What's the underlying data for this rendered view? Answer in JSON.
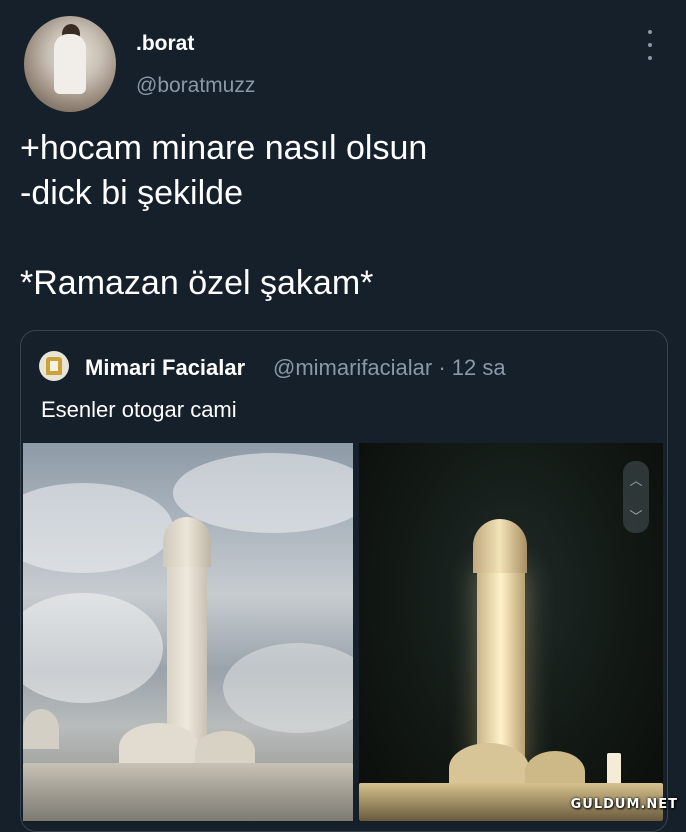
{
  "tweet": {
    "display_name": ".borat",
    "handle": "@boratmuzz",
    "text": "+hocam minare nasıl olsun\n-dick bi şekilde\n\n*Ramazan özel şakam*"
  },
  "quoted_tweet": {
    "display_name": "Mimari Facialar",
    "meta": "@mimarifacialar · 12 sa",
    "text": "Esenler otogar cami"
  },
  "icons": {
    "more": "more-vertical-icon",
    "scroll_up": "chevron-up-icon",
    "scroll_down": "chevron-down-icon"
  },
  "watermark": "GULDUM.NET",
  "colors": {
    "background": "#15202b",
    "secondary_text": "#8b98a5",
    "border": "#38444d"
  }
}
